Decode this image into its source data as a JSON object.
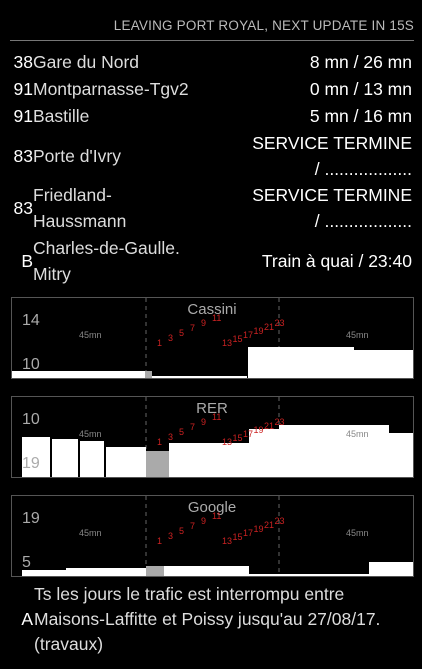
{
  "header": {
    "text": "LEAVING PORT ROYAL, NEXT UPDATE IN 15S"
  },
  "departures": [
    {
      "line": "38",
      "stop": "Gare du Nord",
      "time": "8 mn / 26 mn"
    },
    {
      "line": "91",
      "stop": "Montparnasse-Tgv2",
      "time": "0 mn / 13 mn"
    },
    {
      "line": "91",
      "stop": "Bastille",
      "time": "5 mn / 16 mn"
    },
    {
      "line": "83",
      "stop": "Porte d'Ivry",
      "time": "SERVICE TERMINE / .................."
    },
    {
      "line": "83",
      "stop": "Friedland-Haussmann",
      "time": "SERVICE TERMINE / .................."
    },
    {
      "line": "B",
      "stop": "Charles-de-Gaulle. Mitry",
      "time": "Train à quai / 23:40"
    }
  ],
  "panels": [
    {
      "title": "Cassini",
      "top_label": "14",
      "bottom_label": "10",
      "mn_label": "45mn",
      "hours": [
        "1",
        "3",
        "5",
        "7",
        "9",
        "11",
        "13",
        "15",
        "17",
        "19",
        "21",
        "23"
      ]
    },
    {
      "title": "RER",
      "top_label": "10",
      "bottom_label": "19",
      "mn_label": "45mn",
      "hours": [
        "1",
        "3",
        "5",
        "7",
        "9",
        "11",
        "13",
        "15",
        "17",
        "19",
        "21",
        "23"
      ]
    },
    {
      "title": "Google",
      "top_label": "19",
      "bottom_label": "5",
      "mn_label": "45mn",
      "hours": [
        "1",
        "3",
        "5",
        "7",
        "9",
        "11",
        "13",
        "15",
        "17",
        "19",
        "21",
        "23"
      ]
    }
  ],
  "alert": {
    "line": "A",
    "text": "Ts les jours le trafic est interrompu entre Maisons-Laffitte et Poissy jusqu'au 27/08/17. (travaux)"
  },
  "colors": {
    "accent_red": "#cc2222",
    "grid": "#666666",
    "bar": "#ffffff"
  }
}
